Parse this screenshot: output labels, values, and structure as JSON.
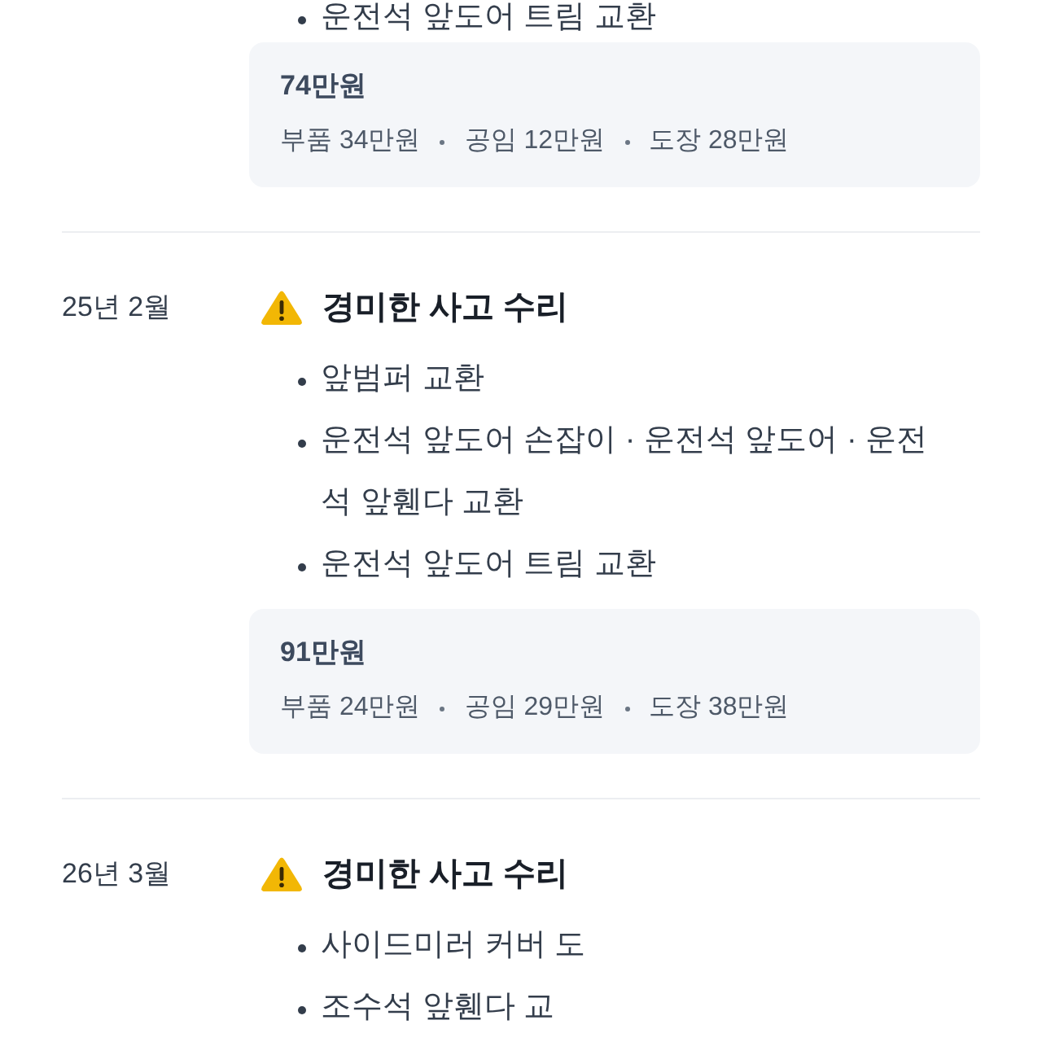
{
  "records": [
    {
      "items": [
        "운전석 앞도어 트림 교환"
      ],
      "cost": {
        "total": "74만원",
        "breakdown": [
          "부품 34만원",
          "공임 12만원",
          "도장 28만원"
        ]
      }
    },
    {
      "date": "25년 2월",
      "title": "경미한 사고 수리",
      "items": [
        "앞범퍼 교환",
        "운전석 앞도어 손잡이 · 운전석 앞도어 · 운전석 앞휀다 교환",
        "운전석 앞도어 트림 교환"
      ],
      "cost": {
        "total": "91만원",
        "breakdown": [
          "부품 24만원",
          "공임 29만원",
          "도장 38만원"
        ]
      }
    },
    {
      "date": "26년 3월",
      "title": "경미한 사고 수리",
      "items": [
        "사이드미러 커버 도",
        "조수석 앞휀다 교"
      ]
    }
  ]
}
